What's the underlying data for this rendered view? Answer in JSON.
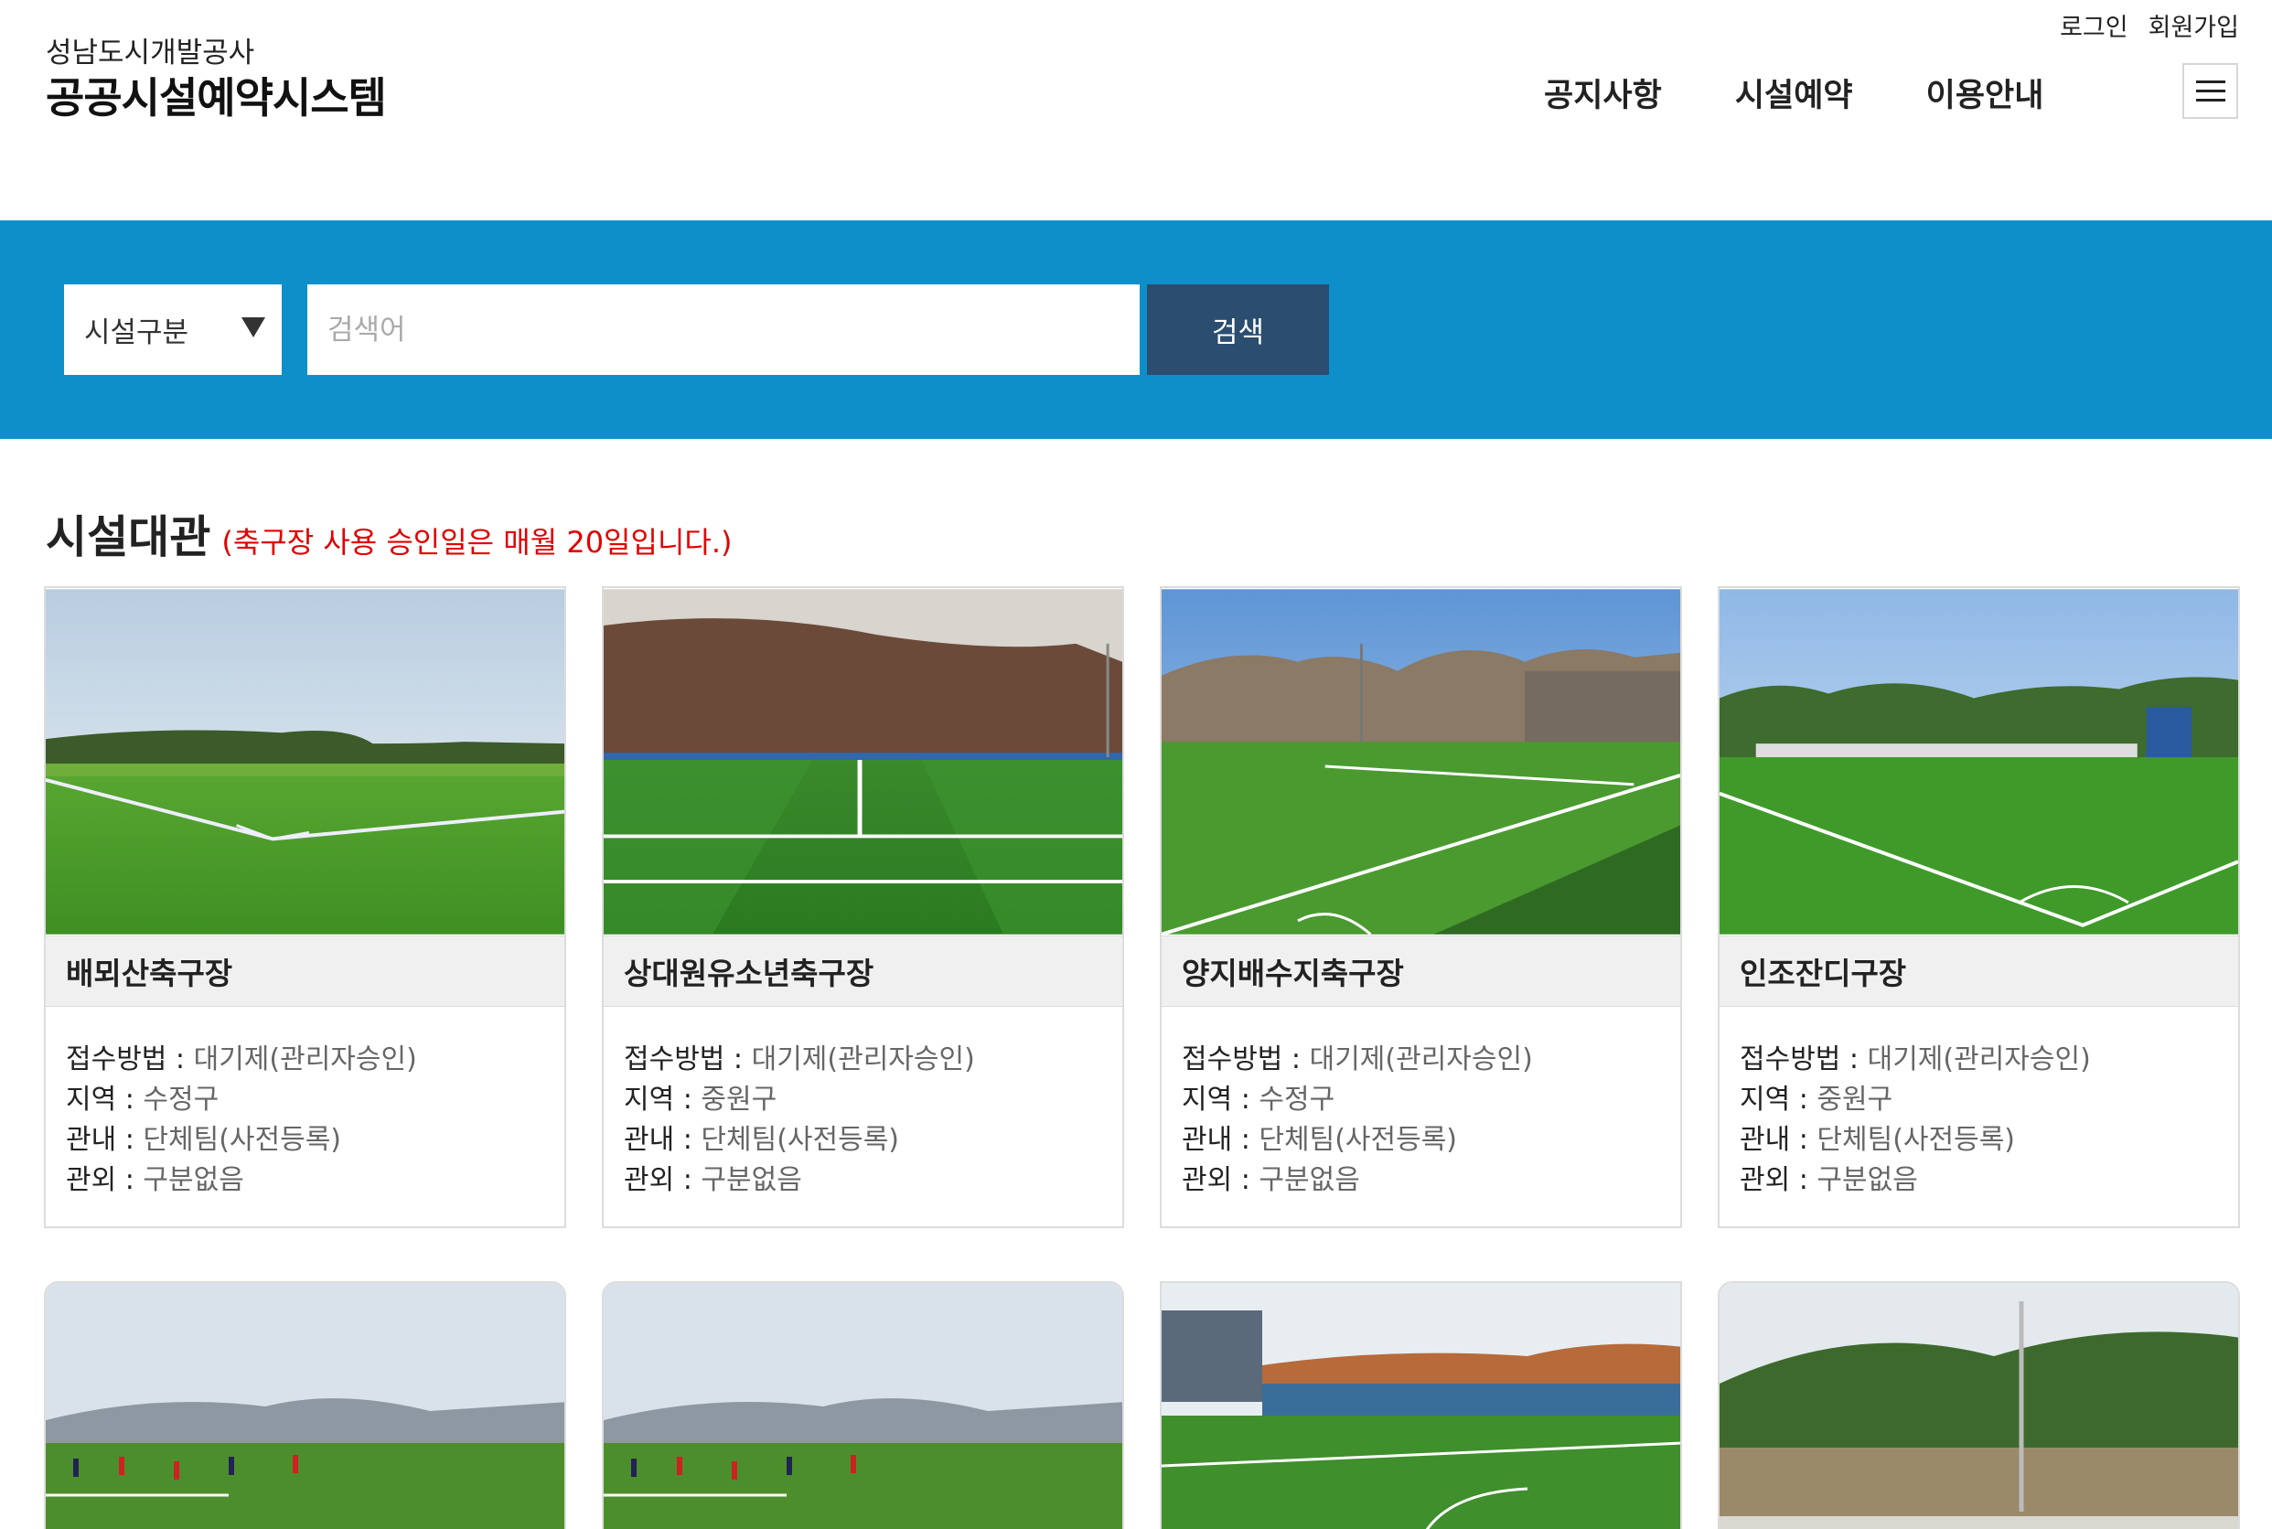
{
  "header": {
    "org_name": "성남도시개발공사",
    "system_name": "공공시설예약시스템",
    "util_links": [
      "로그인",
      "회원가입"
    ],
    "nav": [
      "공지사항",
      "시설예약",
      "이용안내"
    ]
  },
  "search": {
    "select_label": "시설구분",
    "placeholder": "검색어",
    "button_label": "검색"
  },
  "section": {
    "title": "시설대관",
    "note": "(축구장 사용 승인일은 매월 20일입니다.)"
  },
  "labels": {
    "method": "접수방법 : ",
    "region": "지역 : ",
    "inside": "관내 : ",
    "outside": "관외 : "
  },
  "facilities": [
    {
      "name": "배뫼산축구장",
      "method": "대기제(관리자승인)",
      "region": "수정구",
      "inside": "단체팀(사전등록)",
      "outside": "구분없음"
    },
    {
      "name": "상대원유소년축구장",
      "method": "대기제(관리자승인)",
      "region": "중원구",
      "inside": "단체팀(사전등록)",
      "outside": "구분없음"
    },
    {
      "name": "양지배수지축구장",
      "method": "대기제(관리자승인)",
      "region": "수정구",
      "inside": "단체팀(사전등록)",
      "outside": "구분없음"
    },
    {
      "name": "인조잔디구장",
      "method": "대기제(관리자승인)",
      "region": "중원구",
      "inside": "단체팀(사전등록)",
      "outside": "구분없음"
    }
  ],
  "colors": {
    "band": "#0e8fc9",
    "search_button": "#2b4d6f",
    "note": "#e00000"
  }
}
